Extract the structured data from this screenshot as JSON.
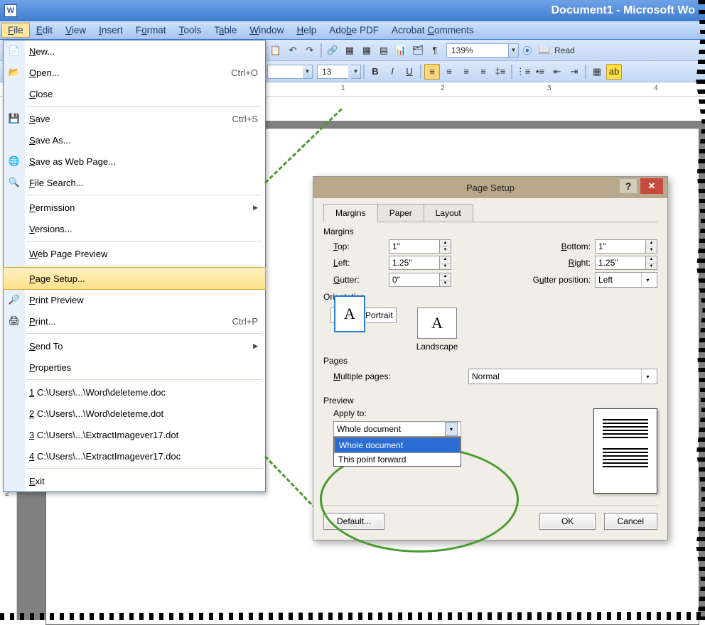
{
  "title": "Document1 - Microsoft Wo",
  "menus": [
    "File",
    "Edit",
    "View",
    "Insert",
    "Format",
    "Tools",
    "Table",
    "Window",
    "Help",
    "Adobe PDF",
    "Acrobat Comments"
  ],
  "menu_ul": [
    "F",
    "E",
    "V",
    "I",
    "o",
    "T",
    "a",
    "W",
    "H",
    "",
    ""
  ],
  "zoom": "139%",
  "read": "Read",
  "font_size": "13",
  "ruler_marks": [
    "1",
    "2",
    "3",
    "4"
  ],
  "vruler": [
    "2"
  ],
  "file_menu": [
    {
      "icon": "📄",
      "label": "New...",
      "sc": ""
    },
    {
      "icon": "📂",
      "label": "Open...",
      "sc": "Ctrl+O"
    },
    {
      "icon": "",
      "label": "Close",
      "sc": ""
    },
    {
      "sep": true
    },
    {
      "icon": "💾",
      "label": "Save",
      "sc": "Ctrl+S"
    },
    {
      "icon": "",
      "label": "Save As...",
      "sc": ""
    },
    {
      "icon": "🌐",
      "label": "Save as Web Page...",
      "sc": ""
    },
    {
      "icon": "🔍",
      "label": "File Search...",
      "sc": ""
    },
    {
      "sep": true
    },
    {
      "icon": "",
      "label": "Permission",
      "sub": true
    },
    {
      "icon": "",
      "label": "Versions...",
      "sc": ""
    },
    {
      "sep": true
    },
    {
      "icon": "",
      "label": "Web Page Preview",
      "sc": ""
    },
    {
      "sep": true
    },
    {
      "icon": "",
      "label": "Page Setup...",
      "sc": "",
      "hl": true
    },
    {
      "icon": "🔎",
      "label": "Print Preview",
      "sc": ""
    },
    {
      "icon": "🖨",
      "label": "Print...",
      "sc": "Ctrl+P"
    },
    {
      "sep": true
    },
    {
      "icon": "",
      "label": "Send To",
      "sub": true
    },
    {
      "icon": "",
      "label": "Properties",
      "sc": ""
    },
    {
      "sep": true
    },
    {
      "icon": "",
      "label": "1 C:\\Users\\...\\Word\\deleteme.doc",
      "sc": ""
    },
    {
      "icon": "",
      "label": "2 C:\\Users\\...\\Word\\deleteme.dot",
      "sc": ""
    },
    {
      "icon": "",
      "label": "3 C:\\Users\\...\\ExtractImagever17.dot",
      "sc": ""
    },
    {
      "icon": "",
      "label": "4 C:\\Users\\...\\ExtractImagever17.doc",
      "sc": ""
    },
    {
      "sep": true
    },
    {
      "icon": "",
      "label": "Exit",
      "sc": ""
    }
  ],
  "dialog": {
    "title": "Page Setup",
    "tabs": [
      "Margins",
      "Paper",
      "Layout"
    ],
    "margins_label": "Margins",
    "top_l": "Top:",
    "top_v": "1\"",
    "bottom_l": "Bottom:",
    "bottom_v": "1\"",
    "left_l": "Left:",
    "left_v": "1.25\"",
    "right_l": "Right:",
    "right_v": "1.25\"",
    "gutter_l": "Gutter:",
    "gutter_v": "0\"",
    "gutpos_l": "Gutter position:",
    "gutpos_v": "Left",
    "orient_label": "Orientation",
    "portrait": "Portrait",
    "landscape": "Landscape",
    "pages_label": "Pages",
    "multi_l": "Multiple pages:",
    "multi_v": "Normal",
    "preview_label": "Preview",
    "apply_l": "Apply to:",
    "apply_v": "Whole document",
    "apply_opts": [
      "Whole document",
      "This point forward"
    ],
    "default_btn": "Default...",
    "ok": "OK",
    "cancel": "Cancel"
  }
}
